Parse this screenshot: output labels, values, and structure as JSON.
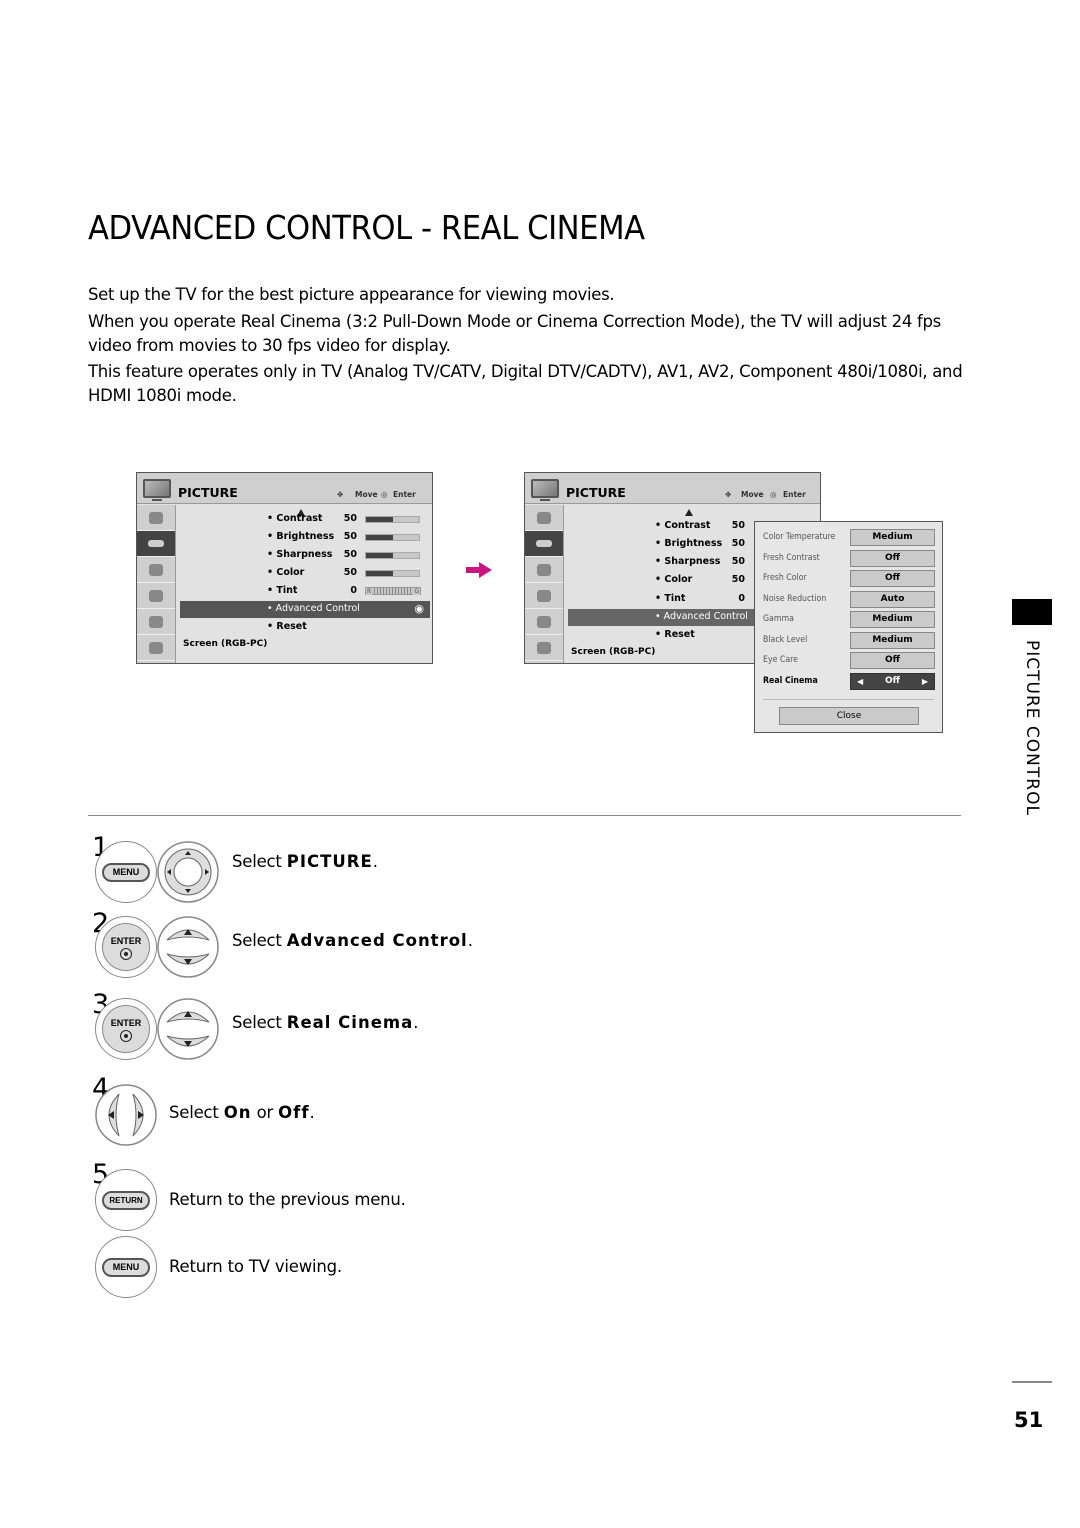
{
  "page": {
    "title": "ADVANCED CONTROL - REAL CINEMA",
    "paragraphs": [
      "Set up the TV for the best picture appearance for viewing movies.",
      "When you operate Real Cinema (3:2 Pull-Down Mode or Cinema Correction Mode), the TV will adjust 24 fps video from movies to 30 fps video for display.",
      "This feature operates only in TV (Analog TV/CATV, Digital DTV/CADTV), AV1, AV2, Component 480i/1080i, and HDMI 1080i mode."
    ],
    "section_label": "PICTURE CONTROL",
    "page_number": "51",
    "accent_color": "#c8157f"
  },
  "menu1": {
    "title": "PICTURE",
    "hint_move": "Move",
    "hint_enter": "Enter",
    "items": [
      {
        "label": "• Contrast",
        "value": "50",
        "level": 0.5
      },
      {
        "label": "• Brightness",
        "value": "50",
        "level": 0.5
      },
      {
        "label": "• Sharpness",
        "value": "50",
        "level": 0.5
      },
      {
        "label": "• Color",
        "value": "50",
        "level": 0.5
      },
      {
        "label": "• Tint",
        "value": "0",
        "tint_left": "R",
        "tint_right": "G"
      },
      {
        "label": "• Advanced Control"
      },
      {
        "label": "• Reset"
      }
    ],
    "footer": "Screen (RGB-PC)"
  },
  "menu2": {
    "title": "PICTURE",
    "hint_move": "Move",
    "hint_enter": "Enter",
    "items": [
      {
        "label": "• Contrast",
        "value": "50"
      },
      {
        "label": "• Brightness",
        "value": "50"
      },
      {
        "label": "• Sharpness",
        "value": "50"
      },
      {
        "label": "• Color",
        "value": "50"
      },
      {
        "label": "• Tint",
        "value": "0"
      },
      {
        "label": "• Advanced Control"
      },
      {
        "label": "• Reset"
      }
    ],
    "footer": "Screen (RGB-PC)"
  },
  "popup": {
    "rows": [
      {
        "label": "Color Temperature",
        "value": "Medium"
      },
      {
        "label": "Fresh Contrast",
        "value": "Off"
      },
      {
        "label": "Fresh Color",
        "value": "Off"
      },
      {
        "label": "Noise Reduction",
        "value": "Auto"
      },
      {
        "label": "Gamma",
        "value": "Medium"
      },
      {
        "label": "Black Level",
        "value": "Medium"
      },
      {
        "label": "Eye Care",
        "value": "Off"
      },
      {
        "label": "Real Cinema",
        "value": "Off"
      }
    ],
    "close_label": "Close"
  },
  "steps": [
    {
      "num": "1",
      "button": "MENU",
      "prefix": "Select ",
      "bold": "PICTURE",
      "suffix": "."
    },
    {
      "num": "2",
      "button": "ENTER",
      "prefix": "Select ",
      "bold": "Advanced Control",
      "suffix": "."
    },
    {
      "num": "3",
      "button": "ENTER",
      "prefix": "Select ",
      "bold": "Real Cinema",
      "suffix": "."
    },
    {
      "num": "4",
      "prefix": "Select ",
      "bold": "On",
      "middle": " or ",
      "bold2": "Off",
      "suffix": "."
    },
    {
      "num": "5",
      "button": "RETURN",
      "text": "Return to the previous menu."
    },
    {
      "button": "MENU",
      "text": "Return to TV viewing."
    }
  ]
}
